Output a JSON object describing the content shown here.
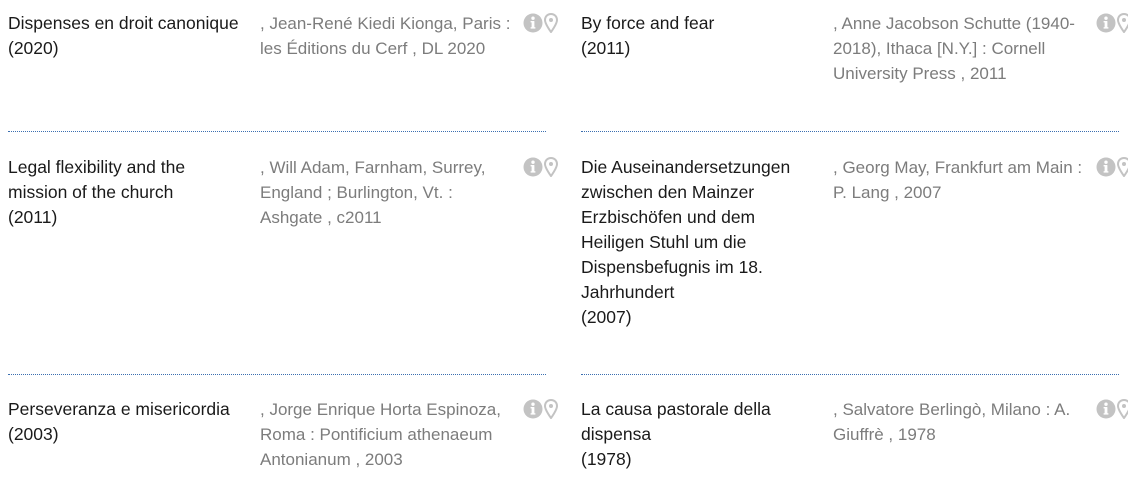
{
  "icons": {
    "info": "info-circle-icon",
    "location": "map-pin-icon",
    "icon_color": "#c3c3c3",
    "separator_color": "#3b6fb0"
  },
  "results": [
    {
      "title": "Dispenses en droit canonique",
      "year": "(2020)",
      "details": ", Jean-René Kiedi Kionga, Paris : les Éditions du Cerf , DL 2020"
    },
    {
      "title": "By force and fear",
      "year": "(2011)",
      "details": ", Anne Jacobson Schutte (1940-2018), Ithaca [N.Y.] : Cornell University Press , 2011"
    },
    {
      "title": "Legal flexibility and the mission of the church",
      "year": "(2011)",
      "details": ", Will Adam, Farnham, Surrey, England ; Burlington, Vt. : Ashgate , c2011"
    },
    {
      "title": "Die Auseinandersetzungen zwischen den Mainzer Erzbischöfen und dem Heiligen Stuhl um die Dispensbefugnis im 18. Jahrhundert",
      "year": "(2007)",
      "details": ", Georg May, Frankfurt am Main : P. Lang , 2007"
    },
    {
      "title": "Perseveranza e misericordia",
      "year": "(2003)",
      "details": ", Jorge Enrique Horta Espinoza, Roma : Pontificium athenaeum Antonianum , 2003"
    },
    {
      "title": "La causa pastorale della dispensa",
      "year": "(1978)",
      "details": ", Salvatore Berlingò, Milano : A. Giuffrè , 1978"
    }
  ]
}
